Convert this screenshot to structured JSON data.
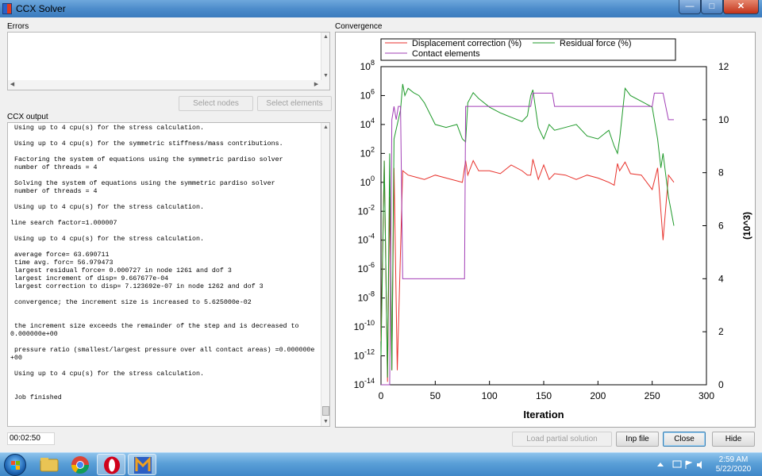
{
  "window": {
    "title": "CCX Solver",
    "min_icon": "minimize-icon",
    "max_icon": "maximize-icon",
    "close_icon": "close-icon"
  },
  "errors": {
    "label": "Errors",
    "value": ""
  },
  "buttons": {
    "select_nodes": "Select nodes",
    "select_elements": "Select elements",
    "load_partial": "Load partial solution",
    "inp_file": "Inp file",
    "close": "Close",
    "hide": "Hide"
  },
  "output": {
    "label": "CCX output",
    "text": " Using up to 4 cpu(s) for the stress calculation.\n\n Using up to 4 cpu(s) for the symmetric stiffness/mass contributions.\n\n Factoring the system of equations using the symmetric pardiso solver\n number of threads = 4\n\n Solving the system of equations using the symmetric pardiso solver\n number of threads = 4\n\n Using up to 4 cpu(s) for the stress calculation.\n\nline search factor=1.000007\n\n Using up to 4 cpu(s) for the stress calculation.\n\n average force= 63.690711\n time avg. forc= 56.979473\n largest residual force= 0.000727 in node 1261 and dof 3\n largest increment of disp= 9.667677e-04\n largest correction to disp= 7.123692e-07 in node 1262 and dof 3\n\n convergence; the increment size is increased to 5.625000e-02\n\n\n the increment size exceeds the remainder of the step and is decreased to\n0.000000e+00\n\n pressure ratio (smallest/largest pressure over all contact areas) =0.000000e\n+00\n\n Using up to 4 cpu(s) for the stress calculation.\n\n\n Job finished"
  },
  "elapsed": "00:02:50",
  "convergence": {
    "label": "Convergence"
  },
  "chart_data": {
    "type": "line",
    "title": "",
    "xlabel": "Iteration",
    "ylabel": "",
    "y2label": "(10^3)",
    "xlim": [
      0,
      300
    ],
    "xticks": [
      "0",
      "50",
      "100",
      "150",
      "200",
      "250",
      "300"
    ],
    "ylim_log": [
      -14,
      8
    ],
    "yticks_exp": [
      "8",
      "6",
      "4",
      "2",
      "0",
      "-2",
      "-4",
      "-6",
      "-8",
      "-10",
      "-12",
      "-14"
    ],
    "y2lim": [
      0,
      12
    ],
    "y2ticks": [
      "12",
      "10",
      "8",
      "6",
      "4",
      "2",
      "0"
    ],
    "legend": [
      "Displacement correction (%)",
      "Residual force (%)",
      "Contact elements"
    ],
    "legend_position": "top",
    "colors": {
      "displacement": "#e8322c",
      "residual": "#1f9a2a",
      "contact": "#a23fb6"
    },
    "series": [
      {
        "name": "Displacement correction (%)",
        "axis": "log",
        "x": [
          0,
          3,
          6,
          8,
          10,
          12,
          15,
          20,
          25,
          30,
          40,
          50,
          60,
          70,
          75,
          78,
          80,
          85,
          90,
          100,
          110,
          120,
          130,
          135,
          138,
          140,
          145,
          150,
          155,
          160,
          170,
          180,
          190,
          200,
          210,
          215,
          218,
          220,
          225,
          230,
          240,
          250,
          255,
          260,
          265,
          270
        ],
        "y": [
          -11,
          1.5,
          -13.8,
          -1,
          -13,
          1,
          -13,
          0.8,
          0.5,
          0.4,
          0.2,
          0.5,
          0.3,
          0.1,
          0,
          1.5,
          0.5,
          1.5,
          0.8,
          0.8,
          0.6,
          1.2,
          0.8,
          0.5,
          0.5,
          1.6,
          0.2,
          1.2,
          0.2,
          0.6,
          0.5,
          0.2,
          0.5,
          0.3,
          0,
          -0.2,
          1.3,
          0.8,
          1.4,
          0.6,
          0.5,
          -0.5,
          1,
          -4,
          0.5,
          0
        ]
      },
      {
        "name": "Residual force (%)",
        "axis": "log",
        "x": [
          0,
          3,
          6,
          8,
          10,
          12,
          15,
          18,
          20,
          22,
          25,
          30,
          35,
          40,
          50,
          60,
          70,
          75,
          78,
          80,
          85,
          90,
          100,
          110,
          120,
          130,
          135,
          138,
          140,
          145,
          150,
          155,
          160,
          170,
          180,
          190,
          200,
          210,
          215,
          218,
          220,
          225,
          230,
          240,
          250,
          255,
          258,
          260,
          265,
          270
        ],
        "y": [
          -12,
          1.5,
          -13.5,
          2,
          -13,
          3,
          4,
          5,
          6.8,
          6,
          6.5,
          6.2,
          6,
          5.5,
          4,
          3.8,
          4,
          3,
          2.8,
          5.5,
          6.2,
          5.8,
          5.2,
          4.8,
          4.5,
          4.2,
          4.6,
          6,
          6.4,
          3.8,
          3,
          4,
          3.6,
          3.8,
          4,
          3.2,
          3,
          3.6,
          2.5,
          2,
          3,
          6.5,
          6,
          5.6,
          5.2,
          3,
          1,
          2,
          -1,
          -3
        ]
      },
      {
        "name": "Contact elements",
        "axis": "linear",
        "x": [
          0,
          5,
          8,
          10,
          12,
          14,
          16,
          18,
          20,
          22,
          24,
          26,
          30,
          35,
          40,
          45,
          50,
          55,
          60,
          65,
          70,
          75,
          77,
          78,
          80,
          85,
          90,
          95,
          100,
          110,
          120,
          130,
          135,
          138,
          140,
          150,
          152,
          155,
          158,
          160,
          165,
          170,
          175,
          180,
          185,
          190,
          200,
          210,
          218,
          219,
          220,
          222,
          225,
          230,
          240,
          250,
          252,
          255,
          258,
          260,
          265,
          270
        ],
        "y": [
          0,
          0,
          0,
          10,
          10.5,
          10,
          10.5,
          10.5,
          4,
          4,
          4,
          4,
          4,
          4,
          4,
          4,
          4,
          4,
          4,
          4,
          4,
          4,
          4,
          10.5,
          10.5,
          10.5,
          10.5,
          10.5,
          10.5,
          10.5,
          10.5,
          10.5,
          10.5,
          10.5,
          11,
          11,
          11,
          11,
          11,
          10.5,
          10.5,
          10.5,
          10.5,
          10.5,
          10.5,
          10.5,
          10.5,
          10.5,
          10.5,
          10.5,
          10.5,
          10.5,
          10.5,
          10.5,
          10.5,
          10.5,
          11,
          11,
          11,
          11,
          10,
          10
        ]
      }
    ]
  },
  "taskbar": {
    "time": "2:59 AM",
    "date": "5/22/2020",
    "apps": [
      "explorer-icon",
      "chrome-icon",
      "opera-icon",
      "app-icon"
    ]
  }
}
